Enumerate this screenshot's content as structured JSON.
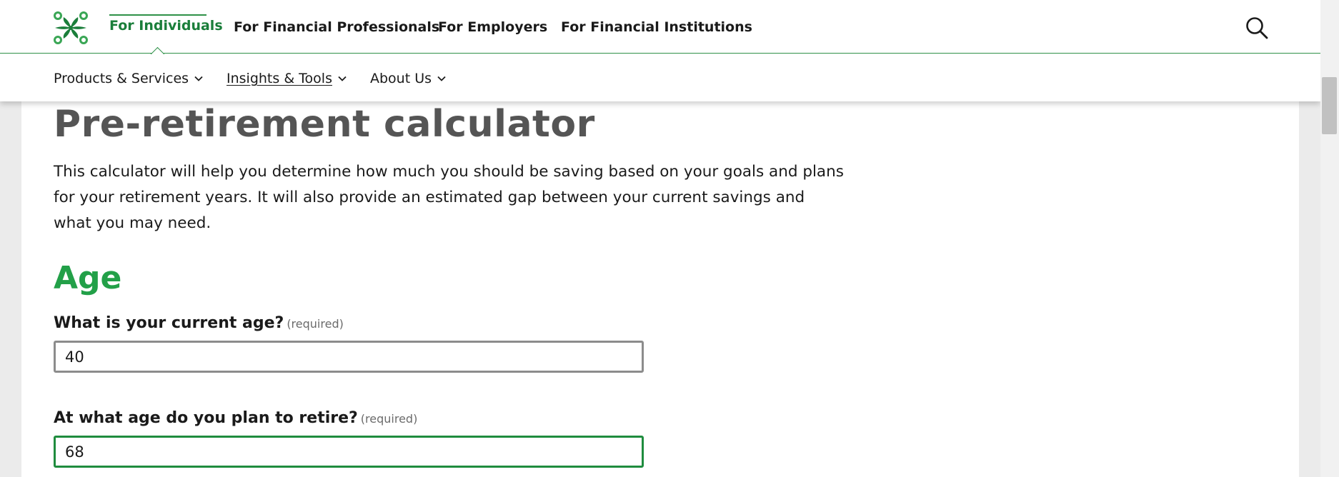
{
  "top_nav": {
    "links": [
      {
        "label": "For Individuals",
        "active": true
      },
      {
        "label": "For Financial Professionals",
        "active": false
      },
      {
        "label": "For Employers",
        "active": false
      },
      {
        "label": "For Financial Institutions",
        "active": false
      }
    ],
    "search_icon": "search-icon",
    "logo_icon": "logo-icon"
  },
  "sub_nav": {
    "items": [
      {
        "label": "Products & Services",
        "icon": "chevron-down-icon"
      },
      {
        "label": "Insights & Tools",
        "icon": "chevron-down-icon"
      },
      {
        "label": "About Us",
        "icon": "chevron-down-icon"
      }
    ]
  },
  "main": {
    "title": "Pre-retirement calculator",
    "intro": "This calculator will help you determine how much you should be saving based on your goals and plans for your retirement years. It will also provide an estimated gap between your current savings and what you may need.",
    "section_heading": "Age",
    "questions": [
      {
        "label": "What is your current age?",
        "required": "(required)",
        "value": "40"
      },
      {
        "label": "At what age do you plan to retire?",
        "required": "(required)",
        "value": "68"
      }
    ]
  },
  "colors": {
    "brand_green": "#1a7e3a",
    "heading_green": "#22a048",
    "title_gray": "#555555"
  }
}
